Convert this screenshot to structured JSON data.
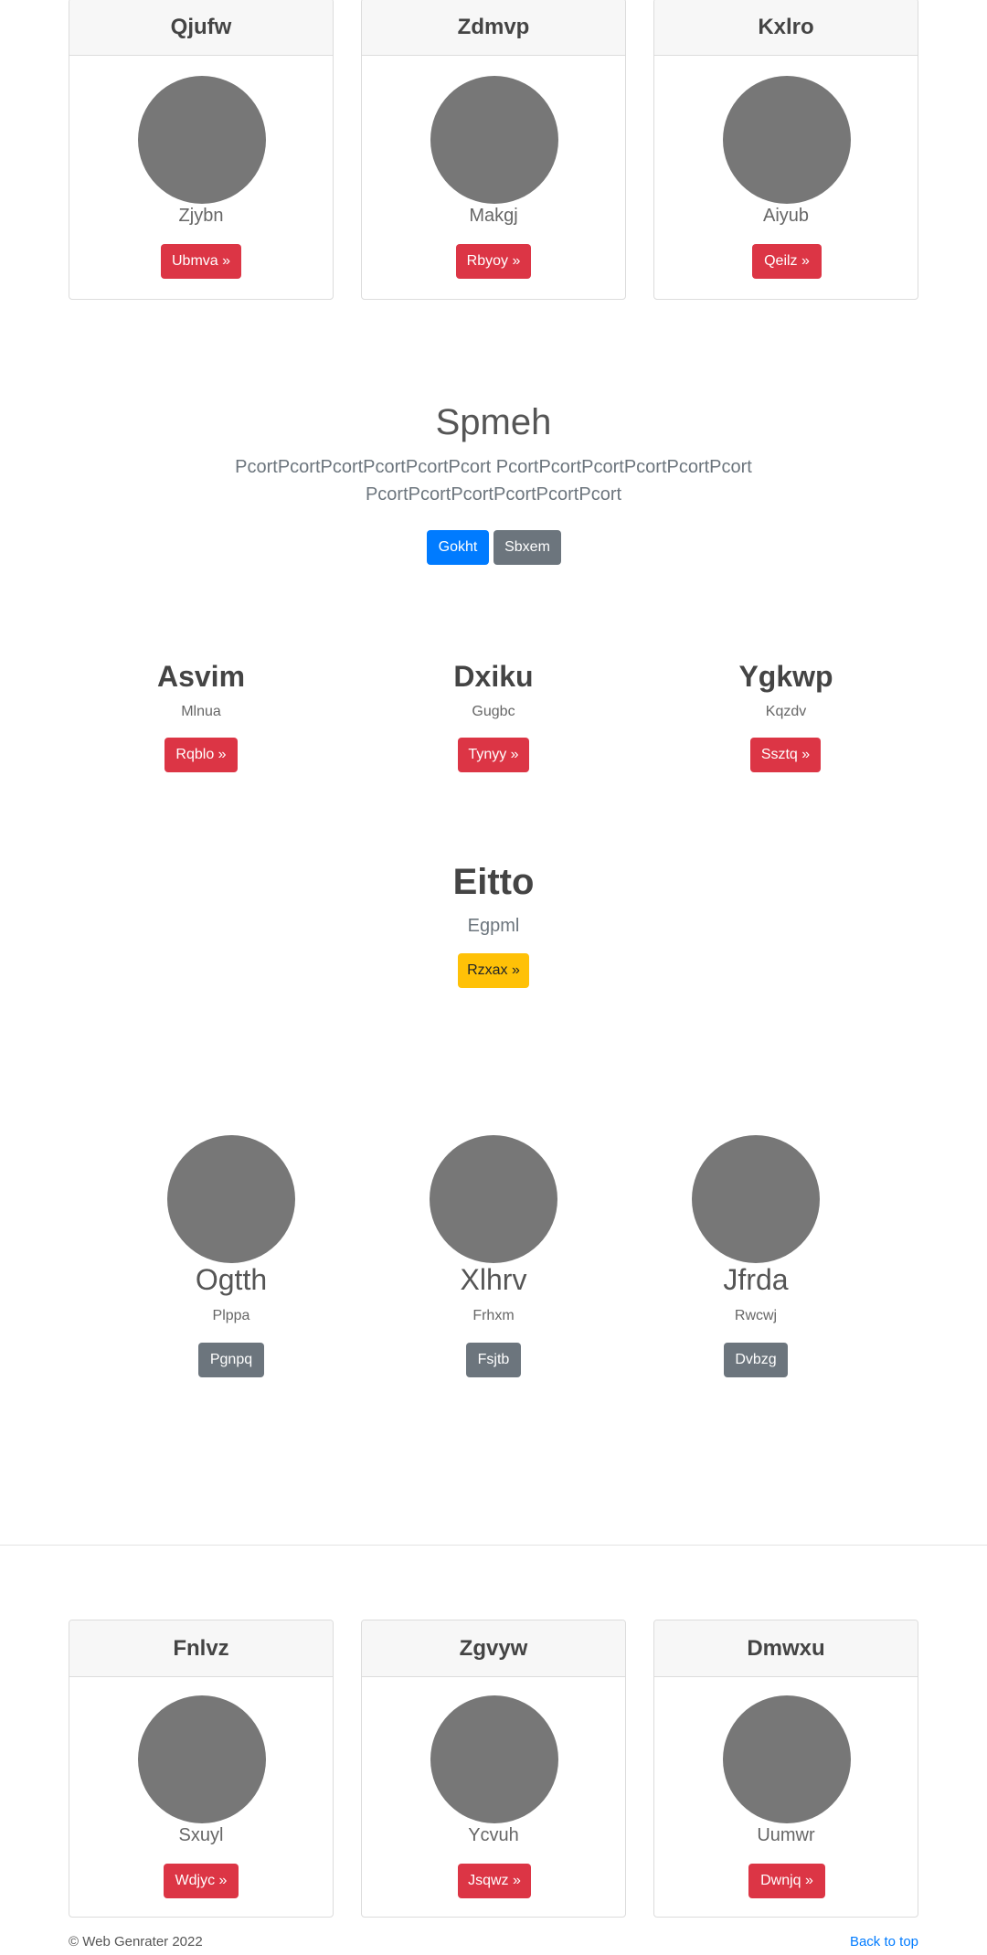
{
  "top_cards": [
    {
      "title": "Qjufw",
      "subtitle": "Zjybn",
      "button": "Ubmva »"
    },
    {
      "title": "Zdmvp",
      "subtitle": "Makgj",
      "button": "Rbyoy »"
    },
    {
      "title": "Kxlro",
      "subtitle": "Aiyub",
      "button": "Qeilz »"
    }
  ],
  "hero": {
    "title": "Spmeh",
    "line1": "PcortPcortPcortPcortPcortPcort PcortPcortPcortPcortPcortPcort",
    "line2": "PcortPcortPcortPcortPcortPcort",
    "primary_button": "Gokht",
    "secondary_button": "Sbxem"
  },
  "features": [
    {
      "title": "Asvim",
      "subtitle": "Mlnua",
      "button": "Rqblo »"
    },
    {
      "title": "Dxiku",
      "subtitle": "Gugbc",
      "button": "Tynyy »"
    },
    {
      "title": "Ygkwp",
      "subtitle": "Kqzdv",
      "button": "Ssztq »"
    }
  ],
  "callout": {
    "title": "Eitto",
    "subtitle": "Egpml",
    "button": "Rzxax »"
  },
  "profiles": [
    {
      "name": "Ogtth",
      "subtitle": "Plppa",
      "button": "Pgnpq"
    },
    {
      "name": "Xlhrv",
      "subtitle": "Frhxm",
      "button": "Fsjtb"
    },
    {
      "name": "Jfrda",
      "subtitle": "Rwcwj",
      "button": "Dvbzg"
    }
  ],
  "bottom_cards": [
    {
      "title": "Fnlvz",
      "subtitle": "Sxuyl",
      "button": "Wdjyc »"
    },
    {
      "title": "Zgvyw",
      "subtitle": "Ycvuh",
      "button": "Jsqwz »"
    },
    {
      "title": "Dmwxu",
      "subtitle": "Uumwr",
      "button": "Dwnjq »"
    }
  ],
  "footer": {
    "copyright": "© Web Genrater 2022",
    "back_to_top": "Back to top"
  },
  "colors": {
    "danger": "#dc3545",
    "primary": "#007bff",
    "secondary": "#6c757d",
    "warning": "#ffc107",
    "placeholder": "#777777"
  }
}
